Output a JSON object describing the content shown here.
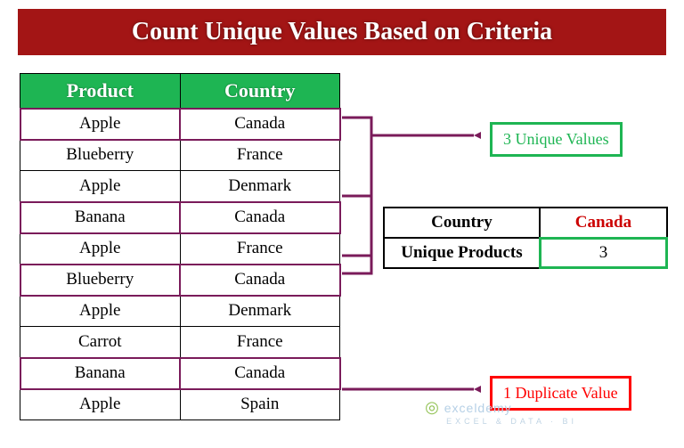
{
  "title": "Count Unique Values Based on Criteria",
  "table": {
    "headers": {
      "product": "Product",
      "country": "Country"
    },
    "rows": [
      {
        "product": "Apple",
        "country": "Canada",
        "hl": true
      },
      {
        "product": "Blueberry",
        "country": "France",
        "hl": false
      },
      {
        "product": "Apple",
        "country": "Denmark",
        "hl": false
      },
      {
        "product": "Banana",
        "country": "Canada",
        "hl": true
      },
      {
        "product": "Apple",
        "country": "France",
        "hl": false
      },
      {
        "product": "Blueberry",
        "country": "Canada",
        "hl": true
      },
      {
        "product": "Apple",
        "country": "Denmark",
        "hl": false
      },
      {
        "product": "Carrot",
        "country": "France",
        "hl": false
      },
      {
        "product": "Banana",
        "country": "Canada",
        "hl": true
      },
      {
        "product": "Apple",
        "country": "Spain",
        "hl": false
      }
    ]
  },
  "side": {
    "country_label": "Country",
    "country_value": "Canada",
    "unique_label": "Unique Products",
    "unique_value": "3"
  },
  "callouts": {
    "unique": "3 Unique Values",
    "duplicate": "1 Duplicate Value"
  },
  "watermark": {
    "text": "exceldemy",
    "sub": "EXCEL & DATA · BI"
  }
}
